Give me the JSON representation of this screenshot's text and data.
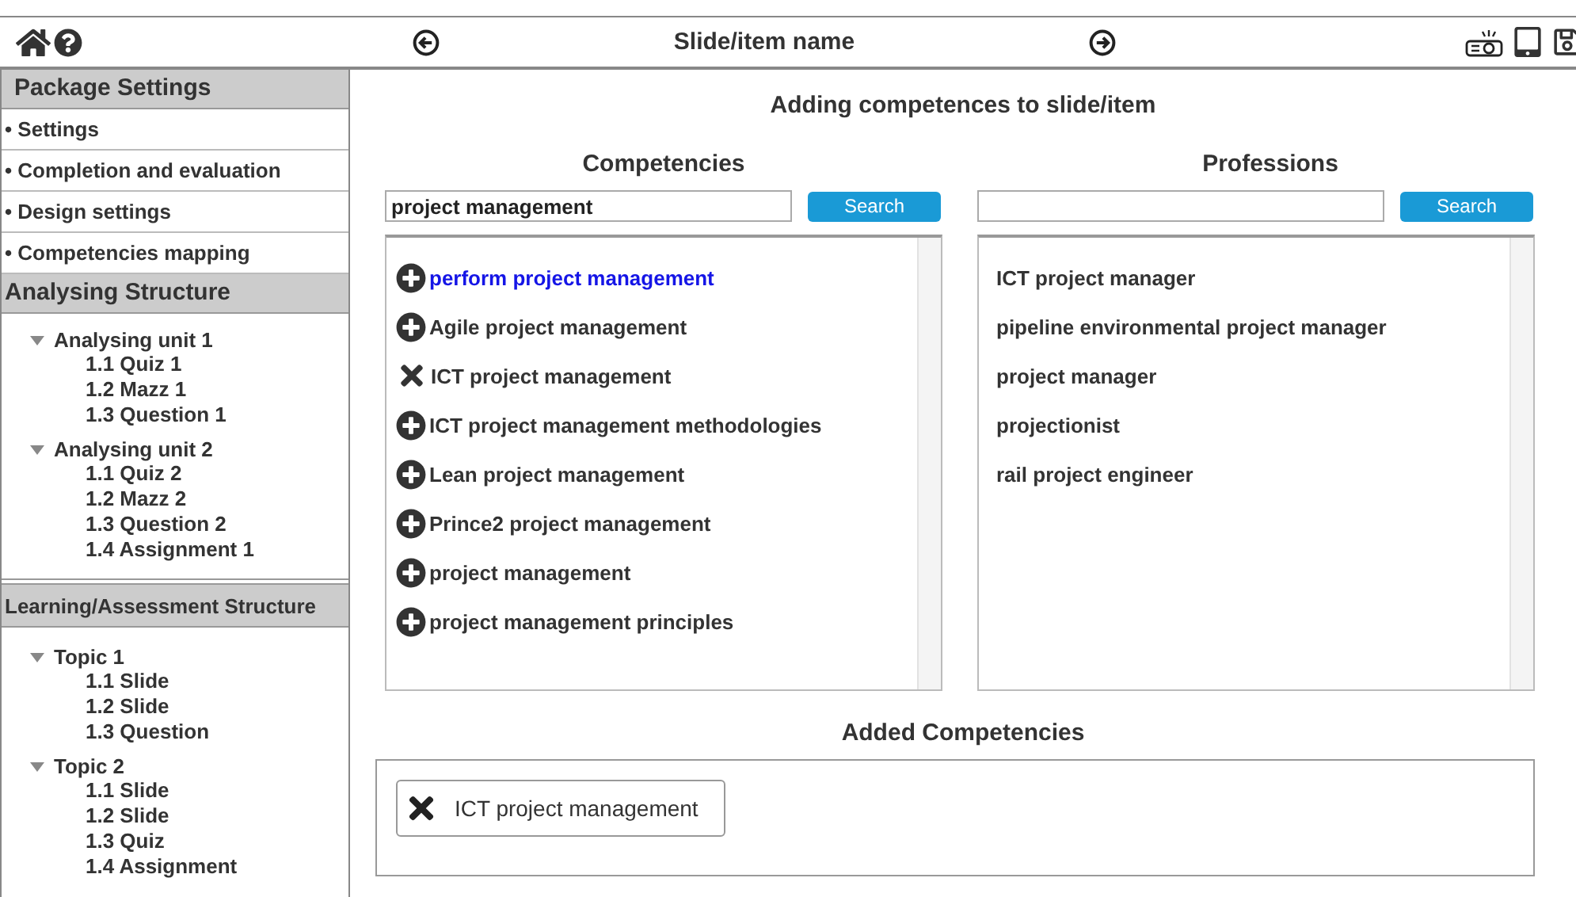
{
  "header": {
    "title": "Slide/item name"
  },
  "sidebar": {
    "sections": [
      {
        "title": "Package Settings",
        "kind": "links",
        "items": [
          {
            "label": "• Settings"
          },
          {
            "label": "• Completion and evaluation"
          },
          {
            "label": "• Design settings"
          },
          {
            "label": "• Competencies mapping"
          }
        ]
      },
      {
        "title": "Analysing Structure",
        "kind": "tree",
        "items": [
          {
            "label": "Analysing unit 1",
            "expanded": true,
            "children": [
              {
                "label": "1.1 Quiz 1"
              },
              {
                "label": "1.2 Mazz 1"
              },
              {
                "label": "1.3 Question 1"
              }
            ]
          },
          {
            "label": "Analysing unit 2",
            "expanded": true,
            "children": [
              {
                "label": "1.1 Quiz 2"
              },
              {
                "label": "1.2 Mazz 2"
              },
              {
                "label": "1.3 Question 2"
              },
              {
                "label": "1.4 Assignment 1"
              }
            ]
          }
        ]
      },
      {
        "title": "Learning/Assessment Structure",
        "kind": "tree",
        "items": [
          {
            "label": "Topic 1",
            "expanded": true,
            "children": [
              {
                "label": "1.1 Slide"
              },
              {
                "label": "1.2 Slide"
              },
              {
                "label": "1.3 Question"
              }
            ]
          },
          {
            "label": "Topic 2",
            "expanded": true,
            "children": [
              {
                "label": "1.1 Slide"
              },
              {
                "label": "1.2 Slide"
              },
              {
                "label": "1.3 Quiz"
              },
              {
                "label": "1.4 Assignment"
              }
            ]
          }
        ]
      }
    ]
  },
  "main": {
    "title": "Adding competences to slide/item",
    "competencies": {
      "heading": "Competencies",
      "search_value": "project management",
      "button": "Search",
      "items": [
        {
          "label": "perform project management",
          "kind": "add",
          "highlighted": true
        },
        {
          "label": "Agile project management",
          "kind": "add",
          "highlighted": false
        },
        {
          "label": "ICT project management",
          "kind": "remove",
          "highlighted": false
        },
        {
          "label": "ICT project management methodologies",
          "kind": "add",
          "highlighted": false
        },
        {
          "label": "Lean project management",
          "kind": "add",
          "highlighted": false
        },
        {
          "label": "Prince2 project management",
          "kind": "add",
          "highlighted": false
        },
        {
          "label": "project management",
          "kind": "add",
          "highlighted": false
        },
        {
          "label": "project management principles",
          "kind": "add",
          "highlighted": false
        }
      ]
    },
    "professions": {
      "heading": "Professions",
      "button": "Search",
      "items": [
        {
          "label": "ICT project manager"
        },
        {
          "label": "pipeline environmental project manager"
        },
        {
          "label": "project manager"
        },
        {
          "label": "projectionist"
        },
        {
          "label": "rail project engineer"
        }
      ]
    },
    "added": {
      "heading": "Added Competencies",
      "items": [
        {
          "label": "ICT project management"
        }
      ]
    }
  }
}
